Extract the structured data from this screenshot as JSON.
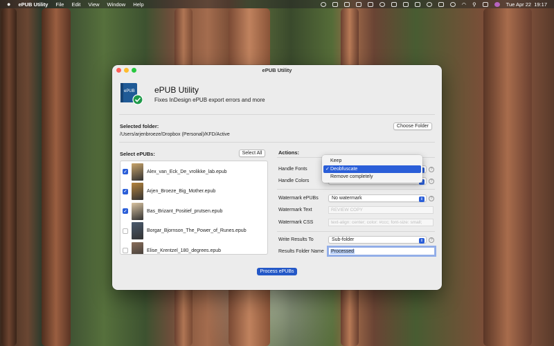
{
  "menubar": {
    "app": "ePUB Utility",
    "items": [
      "File",
      "Edit",
      "View",
      "Window",
      "Help"
    ],
    "datetime": "Tue Apr 22  19:17"
  },
  "window": {
    "title": "ePUB Utility",
    "app_name": "ePUB Utility",
    "app_subtitle": "Fixes InDesign ePUB export errors and more",
    "selected_folder_label": "Selected folder:",
    "selected_folder_path": "/Users/arjenbroeze/Dropbox (Personal)/KFD/Active",
    "choose_folder": "Choose Folder",
    "select_epubs_label": "Select ePUBs:",
    "select_all": "Select All",
    "epubs": [
      {
        "name": "Alex_van_Eck_De_vrolikke_lab.epub",
        "checked": true,
        "cover": "#c8a46a"
      },
      {
        "name": "Arjen_Broeze_Big_Mother.epub",
        "checked": true,
        "cover": "#b5843c"
      },
      {
        "name": "Bas_Brizant_Positief_prutsen.epub",
        "checked": true,
        "cover": "#d8c2a0"
      },
      {
        "name": "Borgar_Bjornson_The_Power_of_Runes.epub",
        "checked": false,
        "cover": "#4a5a6e"
      },
      {
        "name": "Elise_Krentzel_180_degrees.epub",
        "checked": false,
        "cover": "#8a6e5a"
      }
    ],
    "actions_label": "Actions:",
    "handle_fonts_label": "Handle Fonts",
    "handle_colors_label": "Handle Colors",
    "dropdown_options": [
      "Keep",
      "Deobfuscate",
      "Remove completely"
    ],
    "dropdown_selected": "Deobfuscate",
    "watermark_label": "Watermark ePUBs",
    "watermark_value": "No watermark",
    "watermark_text_label": "Watermark Text",
    "watermark_text_placeholder": "REVIEW COPY",
    "watermark_css_label": "Watermark CSS",
    "watermark_css_placeholder": "text-align: center; color: #ccc; font-size: small;",
    "write_results_label": "Write Results To",
    "write_results_value": "Sub-folder",
    "results_folder_label": "Results Folder Name",
    "results_folder_value": "Processed",
    "process_button": "Process ePUBs"
  },
  "colors": {
    "accent": "#2a5ed8",
    "primary_button": "#2458c7",
    "icon_book": "#1f5a96",
    "icon_badge": "#1f9a4a"
  },
  "icons": [
    "apple-icon",
    "wifi-icon",
    "search-icon",
    "battery-icon",
    "checkmark-icon",
    "help-icon",
    "chevron-updown-icon"
  ]
}
